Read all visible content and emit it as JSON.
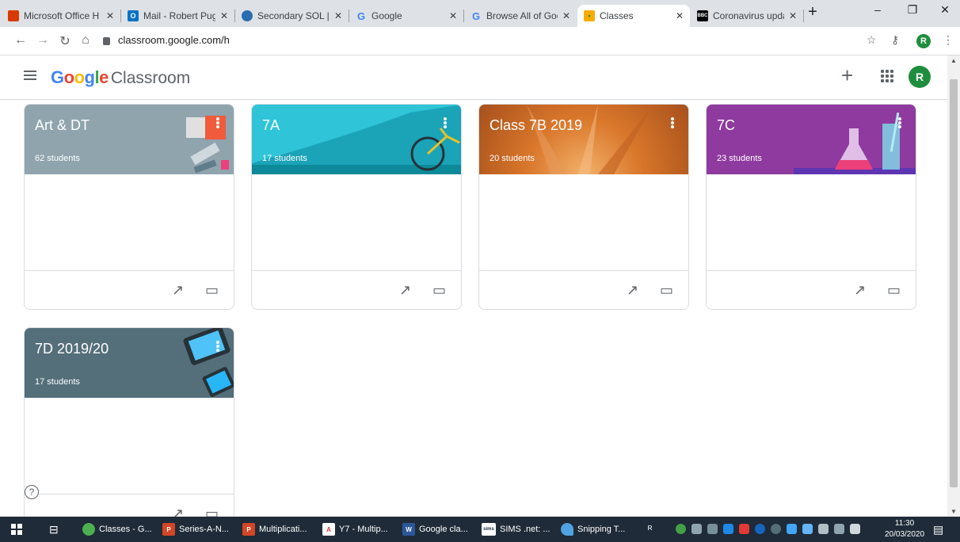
{
  "browser": {
    "tabs": [
      {
        "label": "Microsoft Office H",
        "icon": "office-icon",
        "color": "#d83b01"
      },
      {
        "label": "Mail - Robert Pugh",
        "icon": "outlook-icon",
        "color": "#0072c6"
      },
      {
        "label": "Secondary SOL | W",
        "icon": "sol-icon",
        "color": "#2a6db0"
      },
      {
        "label": "Google",
        "icon": "google-icon",
        "color": "#4285f4"
      },
      {
        "label": "Browse All of Goo",
        "icon": "google-icon",
        "color": "#4285f4"
      },
      {
        "label": "Classes",
        "icon": "classroom-icon",
        "color": "#f9ab00"
      },
      {
        "label": "Coronavirus updat",
        "icon": "bbc-icon",
        "color": "#000000"
      }
    ],
    "url": "classroom.google.com/h",
    "profile_initial": "R"
  },
  "header": {
    "brand_google": "Google",
    "brand_product": "Classroom",
    "avatar_initial": "R"
  },
  "classes": [
    {
      "title": "Art & DT",
      "students": "62 students",
      "color": "#90a4ae"
    },
    {
      "title": "7A",
      "students": "17 students",
      "color": "#2fc4d8"
    },
    {
      "title": "Class 7B 2019",
      "students": "20 students",
      "color": "#d9772b"
    },
    {
      "title": "7C",
      "students": "23 students",
      "color": "#8e3a9e"
    },
    {
      "title": "7D 2019/20",
      "students": "17 students",
      "color": "#546e7a"
    }
  ],
  "taskbar": {
    "items": [
      {
        "label": "Classes - G...",
        "icon": "chrome-icon",
        "color": "#4caf50"
      },
      {
        "label": "Series-A-N...",
        "icon": "powerpoint-icon",
        "color": "#d24726"
      },
      {
        "label": "Multiplicati...",
        "icon": "powerpoint-icon",
        "color": "#d24726"
      },
      {
        "label": "Y7 - Multip...",
        "icon": "pdf-icon",
        "color": "#e53935"
      },
      {
        "label": "Google cla...",
        "icon": "word-icon",
        "color": "#2b579a"
      },
      {
        "label": "SIMS .net: ...",
        "icon": "sims-icon",
        "color": "#ffffff"
      },
      {
        "label": "Snipping T...",
        "icon": "snipping-icon",
        "color": "#4fa3e0"
      }
    ],
    "time": "11:30",
    "date": "20/03/2020"
  }
}
